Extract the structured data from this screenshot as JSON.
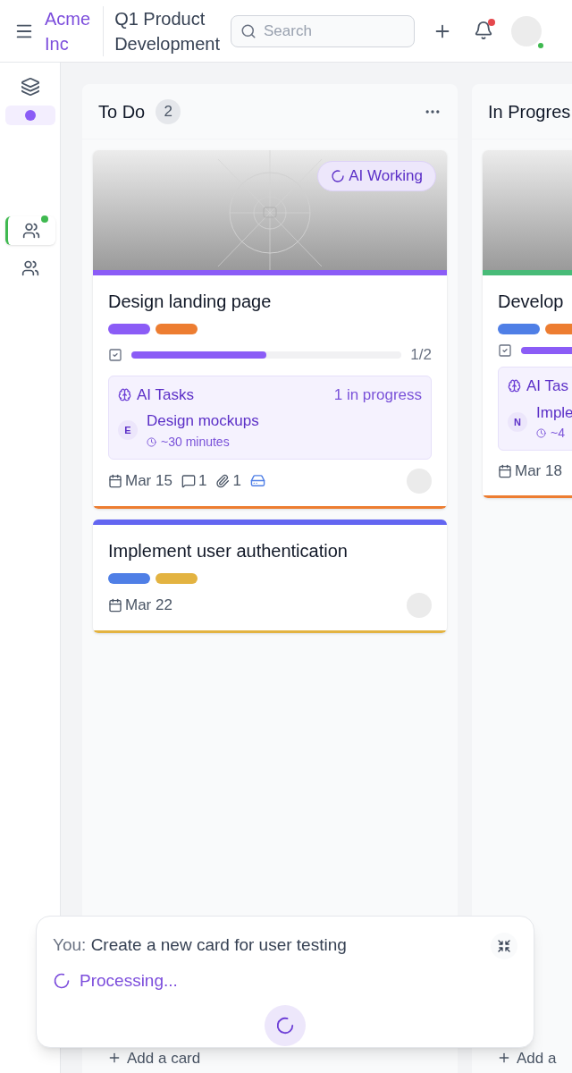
{
  "header": {
    "brand": [
      "Acme",
      "Inc"
    ],
    "project": [
      "Q1 Product",
      "Development"
    ],
    "search": {
      "placeholder": "Search"
    },
    "has_unread": true,
    "online": true
  },
  "sidebar": {
    "items": [
      {
        "kind": "layers",
        "selected": false
      },
      {
        "kind": "dot",
        "selected": true,
        "color": "#8b5cf6"
      },
      {
        "kind": "people",
        "selected": true,
        "badge": true
      },
      {
        "kind": "people",
        "selected": false,
        "badge": false
      }
    ]
  },
  "columns": [
    {
      "title": "To Do",
      "count": "2",
      "add_label": "Add a card",
      "cards": [
        {
          "title": "Design landing page",
          "has_image": true,
          "badge": "AI Working",
          "strip": {
            "color": "#8b5cf6"
          },
          "bottom_bar": {
            "color": "#ed7d31"
          },
          "labels": [
            {
              "color": "#8b5cf6"
            },
            {
              "color": "#ed7d31"
            }
          ],
          "checklist": {
            "level": 0.5,
            "reading": "1/2"
          },
          "ai": {
            "title": "AI Tasks",
            "status": "1 in progress",
            "task": "Design mockups",
            "initial": "E",
            "eta": "~30 minutes"
          },
          "date": "Mar 15",
          "comments": "1",
          "attachments": "1",
          "drive": true,
          "avatar": true
        },
        {
          "title": "Implement user authentication",
          "has_image": false,
          "top_bar": {
            "color": "#6366f1"
          },
          "bottom_bar": {
            "color": "#e3b341"
          },
          "labels": [
            {
              "color": "#4f7fe6"
            },
            {
              "color": "#e3b341"
            }
          ],
          "date": "Mar 22",
          "avatar": true
        }
      ]
    },
    {
      "title": "In Progres",
      "add_label": "Add a",
      "cards": [
        {
          "title": "Develop",
          "has_image": true,
          "strip": {
            "color": "#48bb78"
          },
          "bottom_bar": {
            "color": "#ed7d31"
          },
          "labels": [
            {
              "color": "#4f7fe6"
            },
            {
              "color": "#ed7d31"
            }
          ],
          "checklist": {
            "level": 0.9
          },
          "ai": {
            "title": "AI Tas",
            "task": "Imple",
            "initial": "N",
            "eta": "~4"
          },
          "date": "Mar 18"
        }
      ]
    }
  ],
  "chat": {
    "speaker": "You:",
    "message": "Create a new card for user testing",
    "status": "Processing..."
  }
}
